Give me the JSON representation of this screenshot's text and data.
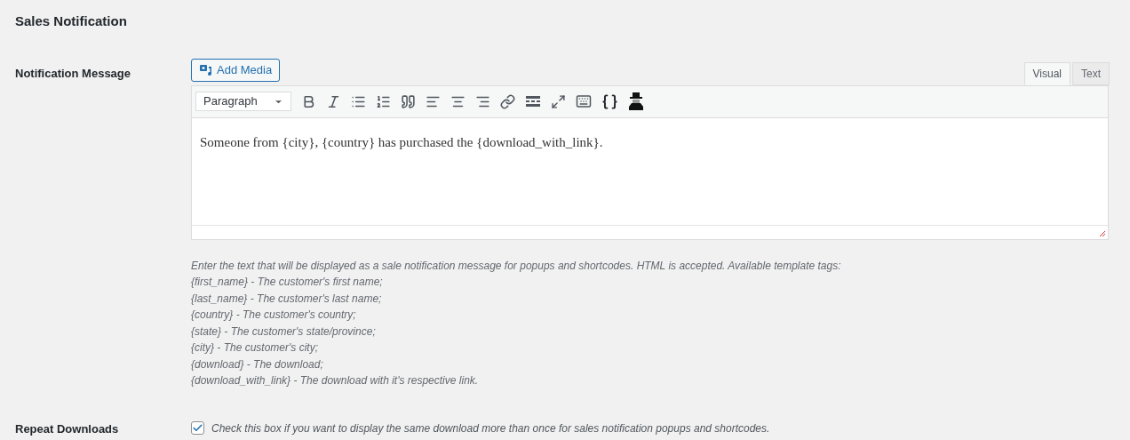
{
  "section_title": "Sales Notification",
  "notification_message": {
    "label": "Notification Message",
    "add_media": "Add Media",
    "tabs": [
      {
        "label": "Visual",
        "selected": true
      },
      {
        "label": "Text",
        "selected": false
      }
    ],
    "format_select": "Paragraph",
    "content": "Someone from {city}, {country} has purchased the {download_with_link}.",
    "description": [
      "Enter the text that will be displayed as a sale notification message for popups and shortcodes. HTML is accepted. Available template tags:",
      "{first_name} - The customer's first name;",
      "{last_name} - The customer's last name;",
      "{country} - The customer's country;",
      "{state} - The customer's state/province;",
      "{city} - The customer's city;",
      "{download} - The download;",
      "{download_with_link} - The download with it's respective link."
    ]
  },
  "repeat_downloads": {
    "label": "Repeat Downloads",
    "checked": true,
    "description": "Check this box if you want to display the same download more than once for sales notification popups and shortcodes."
  }
}
